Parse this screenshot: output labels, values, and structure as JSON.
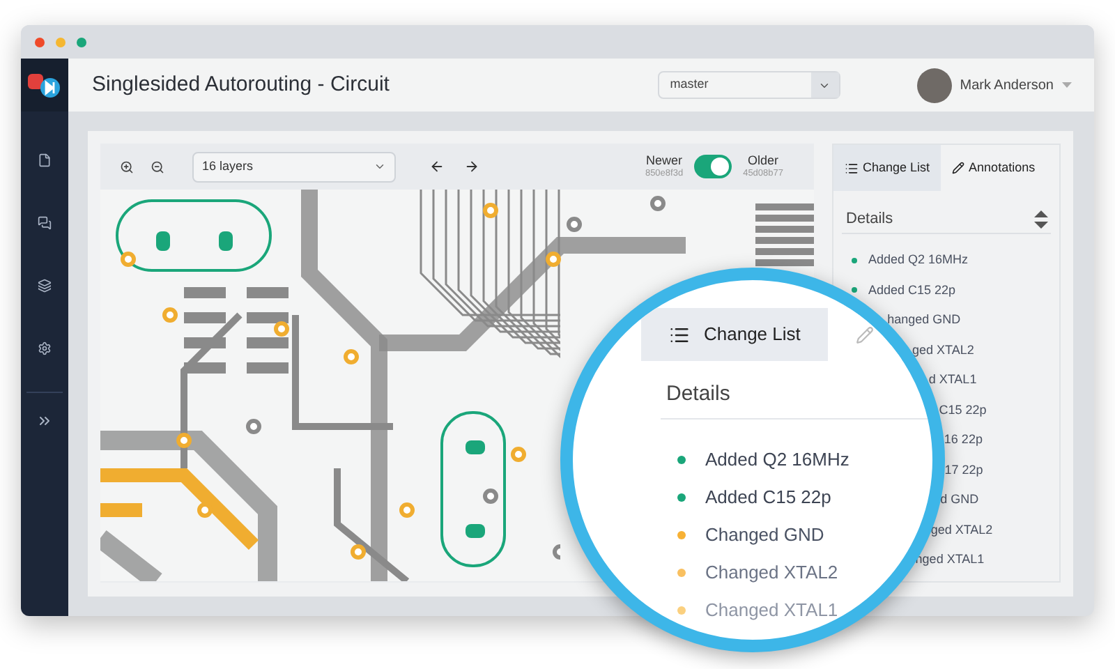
{
  "header": {
    "title": "Singlesided Autorouting - Circuit",
    "branch": "master",
    "user": "Mark Anderson"
  },
  "toolbar": {
    "layers": "16 layers",
    "newer": {
      "label": "Newer",
      "hash": "850e8f3d"
    },
    "older": {
      "label": "Older",
      "hash": "45d08b77"
    },
    "toggle": {
      "on": true
    }
  },
  "panel": {
    "tabs": [
      {
        "label": "Change List",
        "selected": true
      },
      {
        "label": "Annotations",
        "selected": false
      }
    ],
    "heading": "Details",
    "items": [
      {
        "text": "Added Q2 16MHz",
        "color": "#1aa67a"
      },
      {
        "text": "Added C15 22p",
        "color": "#1aa67a"
      },
      {
        "text": "hanged GND"
      },
      {
        "text": "ged XTAL2"
      },
      {
        "text": "d XTAL1"
      },
      {
        "text": "C15 22p"
      },
      {
        "text": "16 22p"
      },
      {
        "text": "17 22p"
      },
      {
        "text": "d GND"
      },
      {
        "text": "ged XTAL2"
      },
      {
        "text": "nged XTAL1"
      }
    ]
  },
  "magnifier": {
    "tabs": [
      {
        "label": "Change List",
        "selected": true
      },
      {
        "kind": "icon",
        "selected": false
      }
    ],
    "heading": "Details",
    "items": [
      {
        "text": "Added Q2 16MHz",
        "color": "#1aa67a"
      },
      {
        "text": "Added C15 22p",
        "color": "#1aa67a"
      },
      {
        "text": "Changed GND",
        "color": "#f7b135"
      },
      {
        "text": "Changed XTAL2",
        "color": "#f9c060"
      },
      {
        "text": "Changed XTAL1",
        "color": "#fbd07f"
      }
    ]
  }
}
